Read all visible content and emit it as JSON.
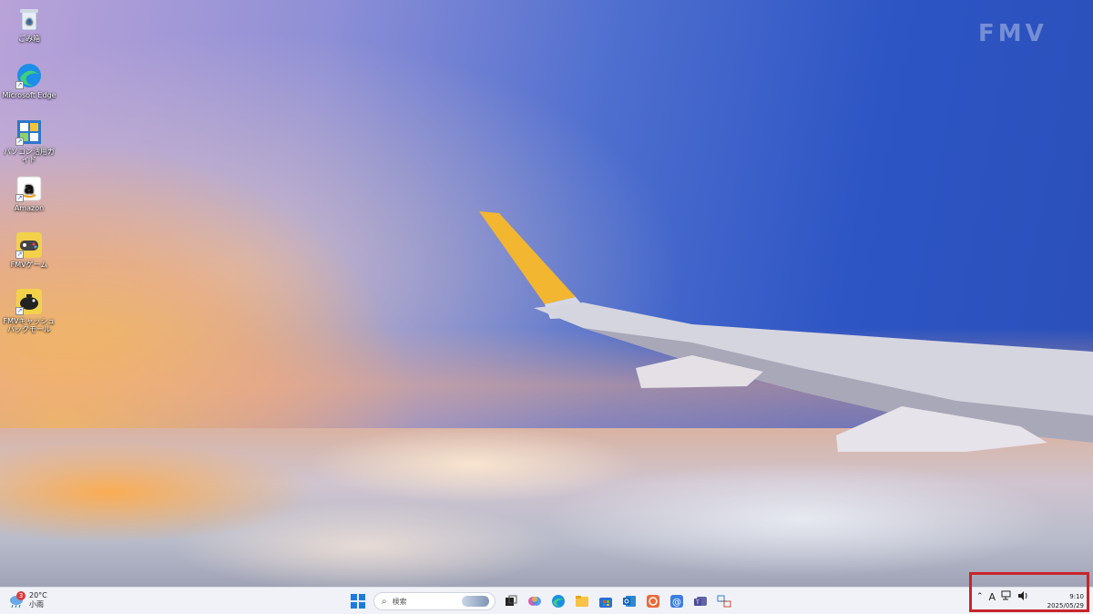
{
  "wallpaper": {
    "brand_watermark": "FMV"
  },
  "desktop_icons": [
    {
      "label": "ごみ箱",
      "icon": "recycle-bin-icon"
    },
    {
      "label": "Microsoft Edge",
      "icon": "edge-icon"
    },
    {
      "label": "パソコン活用ガイド",
      "icon": "pc-guide-icon"
    },
    {
      "label": "Amazon",
      "icon": "amazon-icon"
    },
    {
      "label": "FMVゲーム",
      "icon": "gamepad-icon"
    },
    {
      "label": "FMVキャッシュバックモール",
      "icon": "piggy-bank-icon"
    }
  ],
  "taskbar": {
    "weather": {
      "badge": "3",
      "temp": "20°C",
      "condition": "小雨"
    },
    "search": {
      "placeholder": "検索"
    },
    "pinned": [
      "start-icon",
      "task-view-icon",
      "copilot-icon",
      "edge-icon",
      "file-explorer-icon",
      "store-icon",
      "outlook-icon",
      "office-icon",
      "mail-icon",
      "teams-icon",
      "network-app-icon"
    ],
    "tray": {
      "ime_label": "A",
      "time": "9:10",
      "date": "2025/05/29"
    }
  },
  "colors": {
    "highlight": "#c8242b",
    "taskbar_bg": "#f0f2f7"
  }
}
